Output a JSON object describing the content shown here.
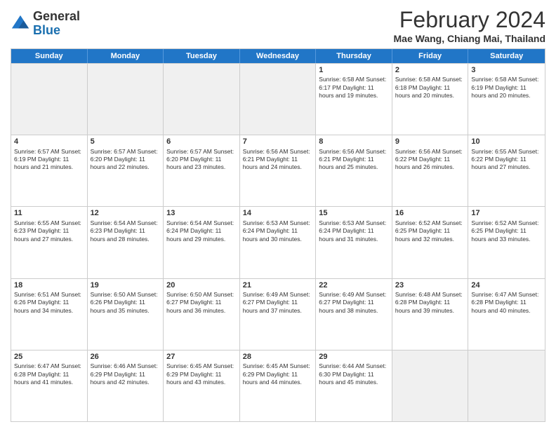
{
  "header": {
    "logo": {
      "general": "General",
      "blue": "Blue"
    },
    "title": "February 2024",
    "location": "Mae Wang, Chiang Mai, Thailand"
  },
  "days_of_week": [
    "Sunday",
    "Monday",
    "Tuesday",
    "Wednesday",
    "Thursday",
    "Friday",
    "Saturday"
  ],
  "rows": [
    [
      {
        "day": "",
        "info": "",
        "shaded": true
      },
      {
        "day": "",
        "info": "",
        "shaded": true
      },
      {
        "day": "",
        "info": "",
        "shaded": true
      },
      {
        "day": "",
        "info": "",
        "shaded": true
      },
      {
        "day": "1",
        "info": "Sunrise: 6:58 AM\nSunset: 6:17 PM\nDaylight: 11 hours and 19 minutes.",
        "shaded": false
      },
      {
        "day": "2",
        "info": "Sunrise: 6:58 AM\nSunset: 6:18 PM\nDaylight: 11 hours and 20 minutes.",
        "shaded": false
      },
      {
        "day": "3",
        "info": "Sunrise: 6:58 AM\nSunset: 6:19 PM\nDaylight: 11 hours and 20 minutes.",
        "shaded": false
      }
    ],
    [
      {
        "day": "4",
        "info": "Sunrise: 6:57 AM\nSunset: 6:19 PM\nDaylight: 11 hours and 21 minutes.",
        "shaded": false
      },
      {
        "day": "5",
        "info": "Sunrise: 6:57 AM\nSunset: 6:20 PM\nDaylight: 11 hours and 22 minutes.",
        "shaded": false
      },
      {
        "day": "6",
        "info": "Sunrise: 6:57 AM\nSunset: 6:20 PM\nDaylight: 11 hours and 23 minutes.",
        "shaded": false
      },
      {
        "day": "7",
        "info": "Sunrise: 6:56 AM\nSunset: 6:21 PM\nDaylight: 11 hours and 24 minutes.",
        "shaded": false
      },
      {
        "day": "8",
        "info": "Sunrise: 6:56 AM\nSunset: 6:21 PM\nDaylight: 11 hours and 25 minutes.",
        "shaded": false
      },
      {
        "day": "9",
        "info": "Sunrise: 6:56 AM\nSunset: 6:22 PM\nDaylight: 11 hours and 26 minutes.",
        "shaded": false
      },
      {
        "day": "10",
        "info": "Sunrise: 6:55 AM\nSunset: 6:22 PM\nDaylight: 11 hours and 27 minutes.",
        "shaded": false
      }
    ],
    [
      {
        "day": "11",
        "info": "Sunrise: 6:55 AM\nSunset: 6:23 PM\nDaylight: 11 hours and 27 minutes.",
        "shaded": false
      },
      {
        "day": "12",
        "info": "Sunrise: 6:54 AM\nSunset: 6:23 PM\nDaylight: 11 hours and 28 minutes.",
        "shaded": false
      },
      {
        "day": "13",
        "info": "Sunrise: 6:54 AM\nSunset: 6:24 PM\nDaylight: 11 hours and 29 minutes.",
        "shaded": false
      },
      {
        "day": "14",
        "info": "Sunrise: 6:53 AM\nSunset: 6:24 PM\nDaylight: 11 hours and 30 minutes.",
        "shaded": false
      },
      {
        "day": "15",
        "info": "Sunrise: 6:53 AM\nSunset: 6:24 PM\nDaylight: 11 hours and 31 minutes.",
        "shaded": false
      },
      {
        "day": "16",
        "info": "Sunrise: 6:52 AM\nSunset: 6:25 PM\nDaylight: 11 hours and 32 minutes.",
        "shaded": false
      },
      {
        "day": "17",
        "info": "Sunrise: 6:52 AM\nSunset: 6:25 PM\nDaylight: 11 hours and 33 minutes.",
        "shaded": false
      }
    ],
    [
      {
        "day": "18",
        "info": "Sunrise: 6:51 AM\nSunset: 6:26 PM\nDaylight: 11 hours and 34 minutes.",
        "shaded": false
      },
      {
        "day": "19",
        "info": "Sunrise: 6:50 AM\nSunset: 6:26 PM\nDaylight: 11 hours and 35 minutes.",
        "shaded": false
      },
      {
        "day": "20",
        "info": "Sunrise: 6:50 AM\nSunset: 6:27 PM\nDaylight: 11 hours and 36 minutes.",
        "shaded": false
      },
      {
        "day": "21",
        "info": "Sunrise: 6:49 AM\nSunset: 6:27 PM\nDaylight: 11 hours and 37 minutes.",
        "shaded": false
      },
      {
        "day": "22",
        "info": "Sunrise: 6:49 AM\nSunset: 6:27 PM\nDaylight: 11 hours and 38 minutes.",
        "shaded": false
      },
      {
        "day": "23",
        "info": "Sunrise: 6:48 AM\nSunset: 6:28 PM\nDaylight: 11 hours and 39 minutes.",
        "shaded": false
      },
      {
        "day": "24",
        "info": "Sunrise: 6:47 AM\nSunset: 6:28 PM\nDaylight: 11 hours and 40 minutes.",
        "shaded": false
      }
    ],
    [
      {
        "day": "25",
        "info": "Sunrise: 6:47 AM\nSunset: 6:28 PM\nDaylight: 11 hours and 41 minutes.",
        "shaded": false
      },
      {
        "day": "26",
        "info": "Sunrise: 6:46 AM\nSunset: 6:29 PM\nDaylight: 11 hours and 42 minutes.",
        "shaded": false
      },
      {
        "day": "27",
        "info": "Sunrise: 6:45 AM\nSunset: 6:29 PM\nDaylight: 11 hours and 43 minutes.",
        "shaded": false
      },
      {
        "day": "28",
        "info": "Sunrise: 6:45 AM\nSunset: 6:29 PM\nDaylight: 11 hours and 44 minutes.",
        "shaded": false
      },
      {
        "day": "29",
        "info": "Sunrise: 6:44 AM\nSunset: 6:30 PM\nDaylight: 11 hours and 45 minutes.",
        "shaded": false
      },
      {
        "day": "",
        "info": "",
        "shaded": true
      },
      {
        "day": "",
        "info": "",
        "shaded": true
      }
    ]
  ]
}
